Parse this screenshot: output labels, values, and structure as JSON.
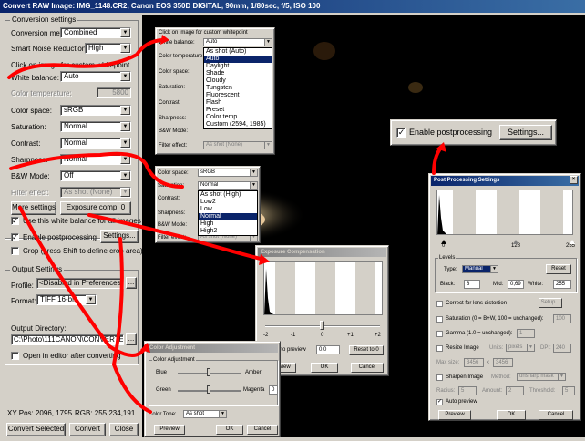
{
  "main": {
    "title": "Convert RAW Image: IMG_1148.CR2, Canon EOS 350D DIGITAL, 90mm, 1/80sec, f/5, ISO 100",
    "conversion_settings": {
      "group_title": "Conversion settings",
      "method_label": "Conversion method:",
      "method_value": "Combined",
      "noise_label": "Smart Noise Reduction:",
      "noise_value": "High",
      "click_hint": "Click on image for custom whitepoint",
      "wb_label": "White balance:",
      "wb_value": "Auto",
      "temp_label": "Color temperature:",
      "temp_value": "5800",
      "colorspace_label": "Color space:",
      "colorspace_value": "sRGB",
      "saturation_label": "Saturation:",
      "saturation_value": "Normal",
      "contrast_label": "Contrast:",
      "contrast_value": "Normal",
      "sharpness_label": "Sharpness:",
      "sharpness_value": "Normal",
      "bw_label": "B&W Mode:",
      "bw_value": "Off",
      "filter_label": "Filter effect:",
      "filter_value": "As shot (None)",
      "more_settings": "More settings",
      "exposure_comp": "Exposure comp: 0",
      "use_wb_label": "Use this white balance for all images",
      "use_wb_checked": "✓"
    },
    "postproc": {
      "enable_label": "Enable postprocessing",
      "enable_checked": "✓",
      "settings_button": "Settings...",
      "crop_label": "Crop (press Shift to define crop area)"
    },
    "output_settings": {
      "group_title": "Output Settings",
      "profile_label": "Profile:",
      "profile_value": "<Disabled in Preferences>",
      "format_label": "Format:",
      "format_value": "TIFF 16-bit",
      "dir_label": "Output Directory:",
      "dir_value": "C:\\Photo\\111CANON\\CONVERTED",
      "browse": "...",
      "open_editor_label": "Open in editor after converting"
    },
    "status": {
      "xy": "XY Pos: 2096, 1795",
      "rgb": "RGB: 255,234,191"
    },
    "buttons": {
      "convert_selected": "Convert Selected",
      "convert": "Convert",
      "close": "Close"
    }
  },
  "wb_popup": {
    "hint": "Click on image for custom whitepoint",
    "wb_label": "White balance:",
    "wb_value": "Auto",
    "temp_label": "Color temperature:",
    "colorspace_label": "Color space:",
    "saturation_label": "Saturation:",
    "contrast_label": "Contrast:",
    "sharpness_label": "Sharpness:",
    "bw_label": "B&W Mode:",
    "filter_label": "Filter effect:",
    "filter_value": "As shot (None)",
    "options": [
      "As shot (Auto)",
      "Auto",
      "Daylight",
      "Shade",
      "Cloudy",
      "Tungsten",
      "Fluorescent",
      "Flash",
      "Preset",
      "Color temp",
      "Custom (2594, 1985)"
    ],
    "selected_index": 1
  },
  "sat_popup": {
    "colorspace_label": "Color space:",
    "colorspace_value": "sRGB",
    "saturation_label": "Saturation:",
    "saturation_value": "Normal",
    "contrast_label": "Contrast:",
    "sharpness_label": "Sharpness:",
    "bw_label": "B&W Mode:",
    "filter_label": "Filter effect:",
    "filter_value": "As shot (None)",
    "options": [
      "As shot (High)",
      "Low2",
      "Low",
      "Normal",
      "High",
      "High2"
    ],
    "selected_index": 3
  },
  "enable_callout": {
    "label": "Enable postprocessing",
    "checked": "✓",
    "settings_button": "Settings..."
  },
  "exposure_dialog": {
    "title": "Exposure Compensation",
    "ticks": [
      "-2",
      "-1",
      "0",
      "+1",
      "+2"
    ],
    "auto_preview_label": "Auto preview",
    "auto_preview_checked": "✓",
    "value": "0,0",
    "reset": "Reset to 0",
    "preview": "Preview",
    "ok": "OK",
    "cancel": "Cancel"
  },
  "color_dialog": {
    "title": "Color Adjustment",
    "group_title": "Color Adjustment",
    "blue_label": "Blue",
    "amber_label": "Amber",
    "green_label": "Green",
    "magenta_label": "Magenta",
    "magenta_value": "0",
    "tone_label": "Color Tone:",
    "tone_value": "As shot",
    "preview": "Preview",
    "ok": "OK",
    "cancel": "Cancel"
  },
  "postproc_dialog": {
    "title": "Post Processing Settings",
    "levels_group": "Levels",
    "scale": [
      "0",
      "128",
      "255"
    ],
    "type_label": "Type:",
    "type_value": "Manual",
    "reset": "Reset",
    "black_label": "Black:",
    "black_value": "8",
    "mid_label": "Mid:",
    "mid_value": "0,69",
    "white_label": "White:",
    "white_value": "255",
    "lens_label": "Correct for lens distortion",
    "lens_setup": "Setup...",
    "saturation_label": "Saturation (0 = B+W, 100 = unchanged):",
    "saturation_value": "100",
    "gamma_label": "Gamma (1.0 = unchanged):",
    "gamma_value": "1",
    "resize_label": "Resize Image",
    "units_label": "Units:",
    "units_value": "pixels",
    "dpi_label": "DPI:",
    "dpi_value": "240",
    "maxsize_label": "Max size:",
    "maxsize_w": "3456",
    "maxsize_x": "x",
    "maxsize_h": "3456",
    "sharpen_label": "Sharpen Image",
    "method_label": "Method:",
    "method_value": "unsharp mask",
    "radius_label": "Radius:",
    "radius_value": "5",
    "amount_label": "Amount:",
    "amount_value": "2",
    "threshold_label": "Threshold:",
    "threshold_value": "5",
    "auto_preview_label": "Auto preview",
    "auto_preview_checked": "✓",
    "preview": "Preview",
    "ok": "OK",
    "cancel": "Cancel"
  },
  "colors": {
    "annotation": "#ff0000",
    "selection": "#0a246a",
    "face": "#d4d0c8"
  }
}
